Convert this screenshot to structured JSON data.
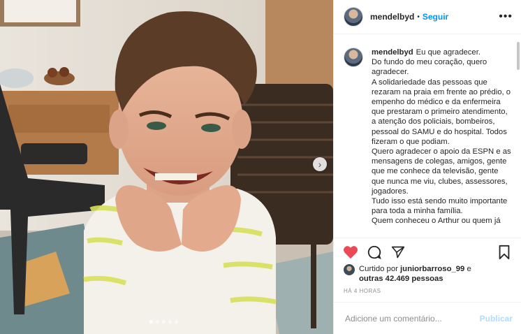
{
  "header": {
    "username": "mendelbyd",
    "separator": "•",
    "follow_label": "Seguir",
    "more_label": "•••"
  },
  "media": {
    "photo_alt": "smiling boy",
    "carousel": {
      "count": 5,
      "active_index": 0
    },
    "next_icon": "chevron-right-icon"
  },
  "caption": {
    "username": "mendelbyd",
    "text": "Eu que agradecer.\nDo fundo do meu coração, quero agradecer.\nA solidariedade das pessoas que rezaram na praia em frente ao prédio, o empenho do médico e da enfermeira que prestaram o primeiro atendimento, a atenção dos policiais, bombeiros, pessoal do SAMU e do hospital. Todos fizeram o que podiam.\nQuero agradecer o apoio da ESPN e as mensagens de colegas, amigos, gente que me conhece da televisão, gente que nunca me viu, clubes, assessores, jogadores.\nTudo isso está sendo muito importante para toda a minha família.\nQuem conheceu o Arthur ou quem já"
  },
  "actions": {
    "like_icon": "heart-filled-icon",
    "comment_icon": "comment-icon",
    "share_icon": "paper-plane-icon",
    "save_icon": "bookmark-icon",
    "like_color": "#ed4956"
  },
  "likes": {
    "prefix": "Curtido por ",
    "user": "juniorbarroso_99",
    "middle": " e",
    "others": "outras 42.469 pessoas"
  },
  "timestamp": "HÁ 4 HORAS",
  "comment": {
    "placeholder": "Adicione um comentário...",
    "publish_label": "Publicar"
  },
  "colors": {
    "link": "#0095f6",
    "publish_disabled": "#b3dbff",
    "muted": "#8e8e8e"
  }
}
